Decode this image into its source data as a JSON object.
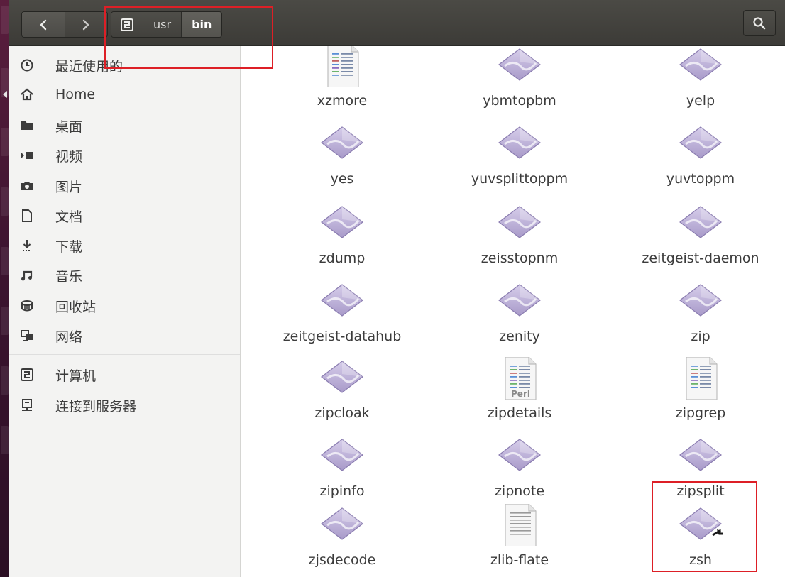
{
  "breadcrumb": {
    "root_icon": "computer-root-icon",
    "items": [
      "usr",
      "bin"
    ],
    "active": "bin"
  },
  "sidebar": {
    "items": [
      {
        "label": "最近使用的",
        "icon": "clock-icon"
      },
      {
        "label": "Home",
        "icon": "home-icon"
      },
      {
        "label": "桌面",
        "icon": "folder-icon"
      },
      {
        "label": "视频",
        "icon": "video-icon"
      },
      {
        "label": "图片",
        "icon": "camera-icon"
      },
      {
        "label": "文档",
        "icon": "document-icon"
      },
      {
        "label": "下载",
        "icon": "download-icon"
      },
      {
        "label": "音乐",
        "icon": "music-icon"
      },
      {
        "label": "回收站",
        "icon": "trash-icon"
      },
      {
        "label": "网络",
        "icon": "network-icon"
      },
      {
        "label": "计算机",
        "icon": "computer-icon"
      },
      {
        "label": "连接到服务器",
        "icon": "server-icon"
      }
    ]
  },
  "files": [
    {
      "name": "xzmore",
      "type": "script-doc"
    },
    {
      "name": "ybmtopbm",
      "type": "executable"
    },
    {
      "name": "yelp",
      "type": "executable"
    },
    {
      "name": "yes",
      "type": "executable"
    },
    {
      "name": "yuvsplittoppm",
      "type": "executable"
    },
    {
      "name": "yuvtoppm",
      "type": "executable"
    },
    {
      "name": "zdump",
      "type": "executable"
    },
    {
      "name": "zeisstopnm",
      "type": "executable"
    },
    {
      "name": "zeitgeist-daemon",
      "type": "executable"
    },
    {
      "name": "zeitgeist-datahub",
      "type": "executable"
    },
    {
      "name": "zenity",
      "type": "executable"
    },
    {
      "name": "zip",
      "type": "executable"
    },
    {
      "name": "zipcloak",
      "type": "executable"
    },
    {
      "name": "zipdetails",
      "type": "perl-doc",
      "badge": "Perl"
    },
    {
      "name": "zipgrep",
      "type": "script-doc"
    },
    {
      "name": "zipinfo",
      "type": "executable"
    },
    {
      "name": "zipnote",
      "type": "executable"
    },
    {
      "name": "zipsplit",
      "type": "executable"
    },
    {
      "name": "zjsdecode",
      "type": "executable"
    },
    {
      "name": "zlib-flate",
      "type": "text-doc"
    },
    {
      "name": "zsh",
      "type": "symlink-executable"
    }
  ],
  "colors": {
    "header_bg": "#3c3b37",
    "sidebar_bg": "#f3f3f2",
    "text": "#3c3c3c",
    "annotation": "#dd1f26",
    "icon_purple": "#a89ac9"
  }
}
